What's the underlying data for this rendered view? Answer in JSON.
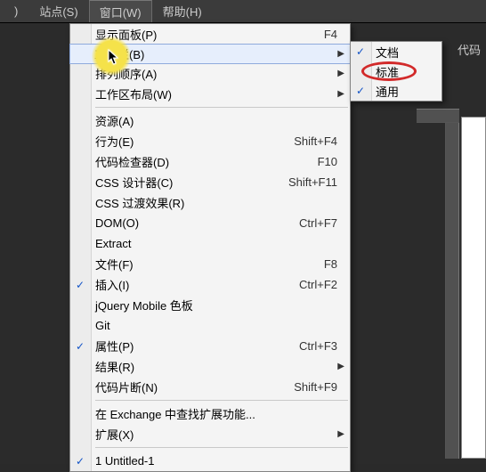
{
  "menubar": {
    "items": [
      {
        "label": ")"
      },
      {
        "label": "站点(S)"
      },
      {
        "label": "窗口(W)"
      },
      {
        "label": "帮助(H)"
      }
    ],
    "active_index": 2
  },
  "side_label": "代码",
  "menu": {
    "items": [
      {
        "label": "显示面板(P)",
        "shortcut": "F4"
      },
      {
        "label": "工具栏(B)",
        "submenu": true,
        "highlight": true
      },
      {
        "label": "排列顺序(A)",
        "submenu": true
      },
      {
        "label": "工作区布局(W)",
        "submenu": true
      },
      {
        "sep": true
      },
      {
        "label": "资源(A)"
      },
      {
        "label": "行为(E)",
        "shortcut": "Shift+F4"
      },
      {
        "label": "代码检查器(D)",
        "shortcut": "F10"
      },
      {
        "label": "CSS 设计器(C)",
        "shortcut": "Shift+F11"
      },
      {
        "label": "CSS 过渡效果(R)"
      },
      {
        "label": "DOM(O)",
        "shortcut": "Ctrl+F7"
      },
      {
        "label": "Extract"
      },
      {
        "label": "文件(F)",
        "shortcut": "F8"
      },
      {
        "label": "插入(I)",
        "shortcut": "Ctrl+F2",
        "checked": true
      },
      {
        "label": "jQuery Mobile 色板"
      },
      {
        "label": "Git"
      },
      {
        "label": "属性(P)",
        "shortcut": "Ctrl+F3",
        "checked": true
      },
      {
        "label": "结果(R)",
        "submenu": true
      },
      {
        "label": "代码片断(N)",
        "shortcut": "Shift+F9"
      },
      {
        "sep": true
      },
      {
        "label": "在 Exchange 中查找扩展功能..."
      },
      {
        "label": "扩展(X)",
        "submenu": true
      },
      {
        "sep": true
      },
      {
        "label": "1 Untitled-1",
        "checked": true
      }
    ]
  },
  "submenu": {
    "items": [
      {
        "label": "文档",
        "checked": true
      },
      {
        "label": "标准",
        "ring": true
      },
      {
        "label": "通用",
        "checked": true
      }
    ]
  }
}
